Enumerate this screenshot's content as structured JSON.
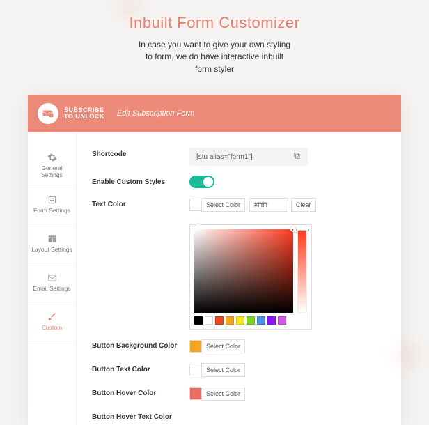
{
  "hero": {
    "title": "Inbuilt Form Customizer",
    "subtitle_l1": "In case you want to give your own styling",
    "subtitle_l2": "to form, we do have interactive inbuilt",
    "subtitle_l3": "form styler"
  },
  "header": {
    "logo_line1": "SUBSCRIBE",
    "logo_line2": "TO UNLOCK",
    "page_title": "Edit Subscription Form"
  },
  "sidebar": {
    "items": [
      {
        "label": "General Settings"
      },
      {
        "label": "Form Settings"
      },
      {
        "label": "Layout Settings"
      },
      {
        "label": "Email Settings"
      },
      {
        "label": "Custom"
      }
    ],
    "active_index": 4
  },
  "fields": {
    "shortcode": {
      "label": "Shortcode",
      "value": "[stu alias=\"form1\"]"
    },
    "enable_custom": {
      "label": "Enable Custom Styles",
      "on": true
    },
    "text_color": {
      "label": "Text Color",
      "select_btn": "Select Color",
      "hex": "#ffffff",
      "clear_btn": "Clear"
    },
    "btn_bg": {
      "label": "Button Background Color",
      "select_btn": "Select Color",
      "swatch": "#f5a623"
    },
    "btn_text": {
      "label": "Button Text Color",
      "select_btn": "Select Color"
    },
    "btn_hover": {
      "label": "Button Hover Color",
      "select_btn": "Select Color",
      "swatch": "#ec6b61"
    },
    "btn_hover_text": {
      "label": "Button Hover Text Color"
    }
  },
  "picker": {
    "presets": [
      "#000000",
      "#ffffff",
      "#ef4523",
      "#f5a623",
      "#f8e71c",
      "#7ed321",
      "#4a90e2",
      "#9013fe",
      "#d258e9"
    ]
  }
}
